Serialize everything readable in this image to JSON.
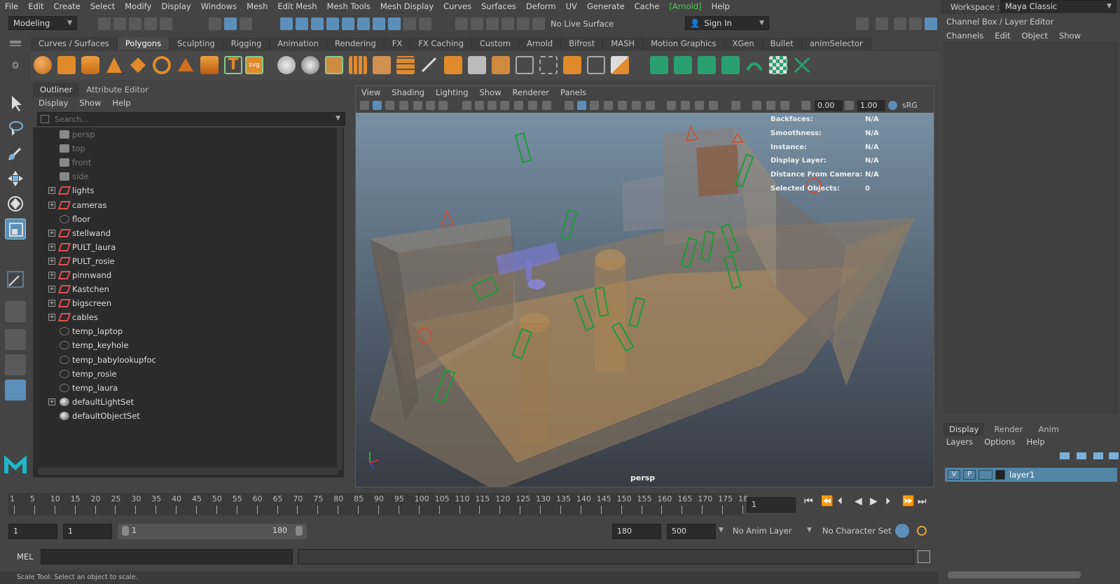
{
  "menubar": [
    "File",
    "Edit",
    "Create",
    "Select",
    "Modify",
    "Display",
    "Windows",
    "Mesh",
    "Edit Mesh",
    "Mesh Tools",
    "Mesh Display",
    "Curves",
    "Surfaces",
    "Deform",
    "UV",
    "Generate",
    "Cache",
    "[Arnold]",
    "Help"
  ],
  "status": {
    "mode": "Modeling",
    "live_surface": "No Live Surface",
    "sign_in": "Sign In"
  },
  "workspace": {
    "label": "Workspace :",
    "value": "Maya Classic"
  },
  "shelf_tabs": [
    "Curves / Surfaces",
    "Polygons",
    "Sculpting",
    "Rigging",
    "Animation",
    "Rendering",
    "FX",
    "FX Caching",
    "Custom",
    "Arnold",
    "Bifrost",
    "MASH",
    "Motion Graphics",
    "XGen",
    "Bullet",
    "animSelector"
  ],
  "shelf_active": "Polygons",
  "outliner": {
    "tabs": [
      "Outliner",
      "Attribute Editor"
    ],
    "menu": [
      "Display",
      "Show",
      "Help"
    ],
    "search_placeholder": "Search...",
    "items": [
      {
        "label": "persp",
        "icon": "camera-icon",
        "dim": true,
        "expandable": false
      },
      {
        "label": "top",
        "icon": "camera-icon",
        "dim": true,
        "expandable": false
      },
      {
        "label": "front",
        "icon": "camera-icon",
        "dim": true,
        "expandable": false
      },
      {
        "label": "side",
        "icon": "camera-icon",
        "dim": true,
        "expandable": false
      },
      {
        "label": "lights",
        "icon": "transform-icon",
        "dim": false,
        "expandable": true
      },
      {
        "label": "cameras",
        "icon": "transform-icon",
        "dim": false,
        "expandable": true
      },
      {
        "label": "floor",
        "icon": "mesh-icon",
        "dim": false,
        "expandable": false
      },
      {
        "label": "stellwand",
        "icon": "transform-icon",
        "dim": false,
        "expandable": true
      },
      {
        "label": "PULT_laura",
        "icon": "transform-icon",
        "dim": false,
        "expandable": true
      },
      {
        "label": "PULT_rosie",
        "icon": "transform-icon",
        "dim": false,
        "expandable": true
      },
      {
        "label": "pinnwand",
        "icon": "transform-icon",
        "dim": false,
        "expandable": true
      },
      {
        "label": "Kastchen",
        "icon": "transform-icon",
        "dim": false,
        "expandable": true
      },
      {
        "label": "bigscreen",
        "icon": "transform-icon",
        "dim": false,
        "expandable": true
      },
      {
        "label": "cables",
        "icon": "transform-icon",
        "dim": false,
        "expandable": true
      },
      {
        "label": "temp_laptop",
        "icon": "mesh-icon",
        "dim": false,
        "expandable": false
      },
      {
        "label": "temp_keyhole",
        "icon": "mesh-icon",
        "dim": false,
        "expandable": false
      },
      {
        "label": "temp_babylookupfoc",
        "icon": "mesh-icon",
        "dim": false,
        "expandable": false
      },
      {
        "label": "temp_rosie",
        "icon": "mesh-icon",
        "dim": false,
        "expandable": false
      },
      {
        "label": "temp_laura",
        "icon": "mesh-icon",
        "dim": false,
        "expandable": false
      },
      {
        "label": "defaultLightSet",
        "icon": "set-icon",
        "dim": false,
        "expandable": true
      },
      {
        "label": "defaultObjectSet",
        "icon": "set-icon",
        "dim": false,
        "expandable": false
      }
    ]
  },
  "viewport": {
    "menu": [
      "View",
      "Shading",
      "Lighting",
      "Show",
      "Renderer",
      "Panels"
    ],
    "exposure": "0.00",
    "gamma": "1.00",
    "color_space": "sRG",
    "camera": "persp",
    "hud": [
      {
        "key": "Backfaces:",
        "value": "N/A"
      },
      {
        "key": "Smoothness:",
        "value": "N/A"
      },
      {
        "key": "Instance:",
        "value": "N/A"
      },
      {
        "key": "Display Layer:",
        "value": "N/A"
      },
      {
        "key": "Distance From Camera:",
        "value": "N/A"
      },
      {
        "key": "Selected Objects:",
        "value": "0"
      }
    ]
  },
  "channel_box": {
    "title": "Channel Box / Layer Editor",
    "menu": [
      "Channels",
      "Edit",
      "Object",
      "Show"
    ]
  },
  "layer_editor": {
    "tabs": [
      "Display",
      "Render",
      "Anim"
    ],
    "menu": [
      "Layers",
      "Options",
      "Help"
    ],
    "layer": {
      "v": "V",
      "p": "P",
      "name": "layer1"
    }
  },
  "timeline": {
    "ticks": [
      "1",
      "5",
      "10",
      "15",
      "20",
      "25",
      "30",
      "35",
      "40",
      "45",
      "50",
      "55",
      "60",
      "65",
      "70",
      "75",
      "80",
      "85",
      "90",
      "95",
      "100",
      "105",
      "110",
      "115",
      "120",
      "125",
      "130",
      "135",
      "140",
      "145",
      "150",
      "155",
      "160",
      "165",
      "170",
      "175",
      "18"
    ],
    "current_frame": "1"
  },
  "range": {
    "start": "1",
    "anim_start": "1",
    "slider_start": "1",
    "slider_end": "180",
    "end": "180",
    "anim_end": "500",
    "anim_layer": "No Anim Layer",
    "char_set": "No Character Set"
  },
  "mel": {
    "label": "MEL"
  },
  "helpline": "Scale Tool: Select an object to scale."
}
